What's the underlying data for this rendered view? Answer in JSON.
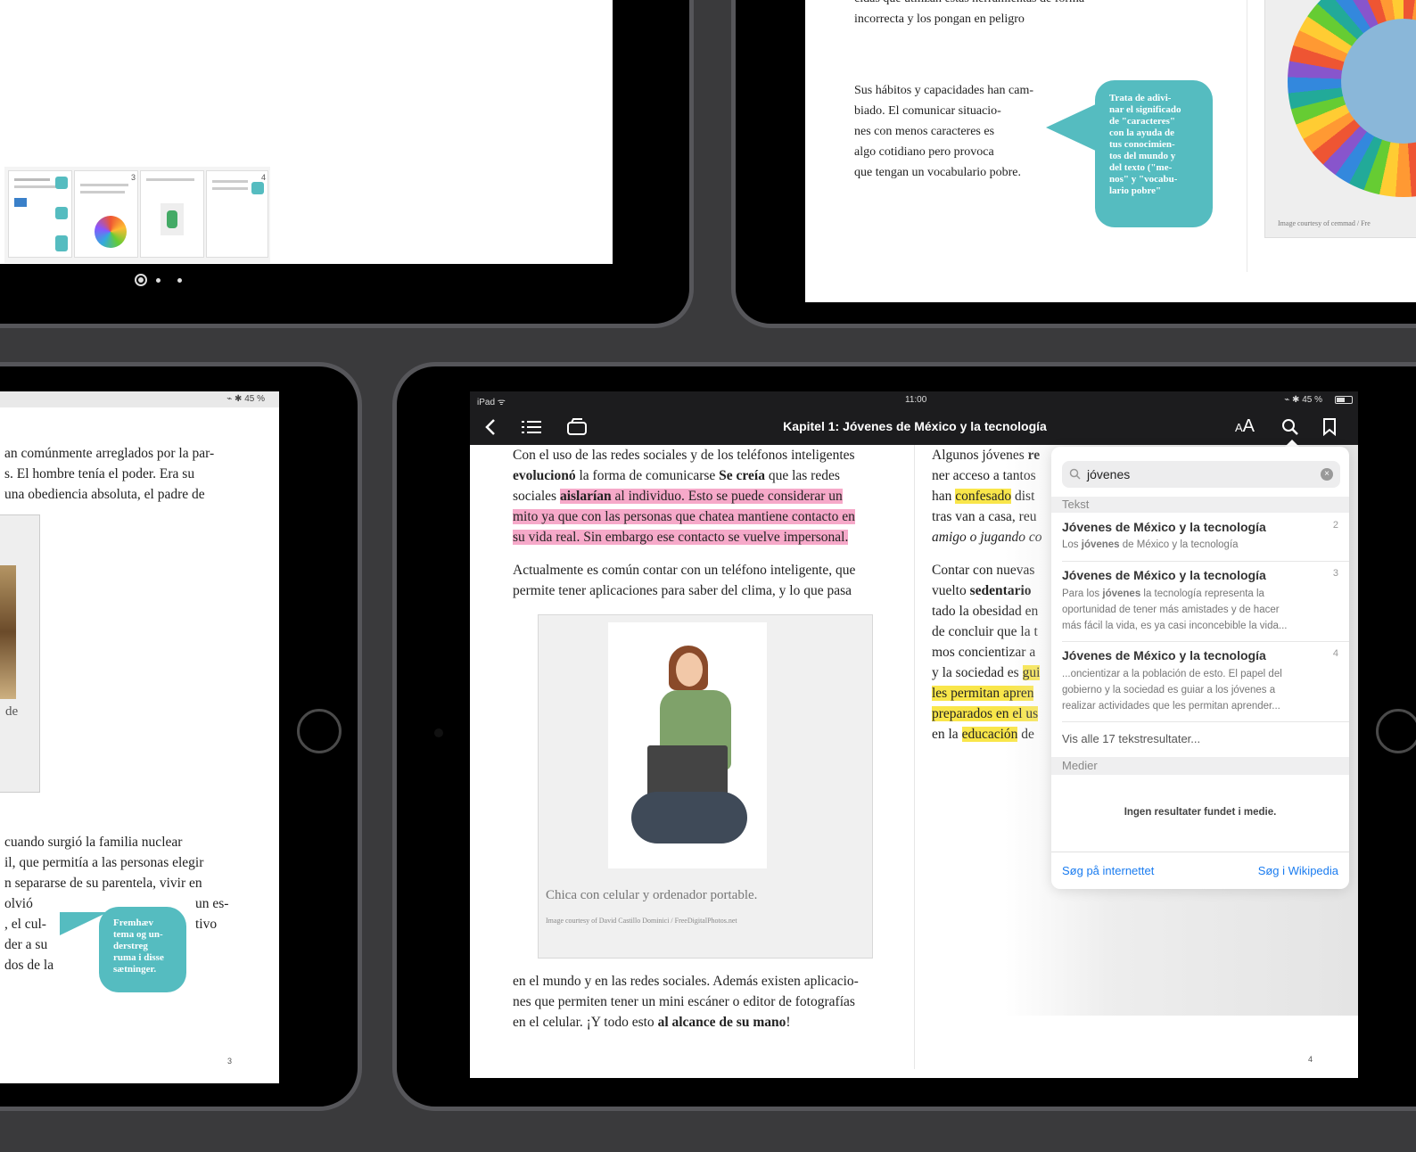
{
  "topleft": {
    "page_dots": [
      "current",
      "dot",
      "dot"
    ],
    "thumb_numbers": [
      "3",
      "4"
    ]
  },
  "topright": {
    "text_top": "cidas que utilizan estas herramientas de forma incorrecta y los pongan en peligro",
    "paragraph": [
      "Sus hábitos y capacidades han cam-",
      "biado. El comunicar situacio-",
      "nes con menos caracteres es",
      "algo cotidiano pero provoca",
      "que tengan un vocabulario pobre."
    ],
    "bubble": [
      "Trata de adivi-",
      "nar el significado",
      "de \"caracteres\"",
      "con la ayuda de",
      "tus conocimien-",
      "tos del mundo y",
      "del texto (\"me-",
      "nos\" y \"vocabu-",
      "lario pobre\""
    ],
    "caption": "Image courtesy of cemmad / Fre"
  },
  "bottomleft": {
    "status_right": "⌁ ✱ 45 %",
    "lines_top": [
      "an comúnmente arreglados por la par-",
      "s. El hombre tenía el poder. Era su",
      "una obediencia absoluta, el padre de"
    ],
    "de_label": "de",
    "lines_bottom": [
      "cuando surgió la familia nuclear",
      "il, que permitía a las personas elegir",
      "n separarse de su parentela, vivir en"
    ],
    "lines_side": [
      "olvió",
      ", el cul-",
      "der a su",
      "dos de la"
    ],
    "lines_right": [
      "un es-",
      "tivo"
    ],
    "bubble": [
      "Fremhæv",
      "tema og un-",
      "derstreg",
      "ruma i disse",
      "sætninger."
    ],
    "page_number": "3"
  },
  "main": {
    "status": {
      "left": "iPad ᯤ",
      "time": "11:00",
      "right": "⌁ ✱ 45 %"
    },
    "toolbar": {
      "title": "Kapitel 1: Jóvenes de México y la tecnología",
      "font_label": "AA"
    },
    "left_col": {
      "p1": {
        "l1": "Con el uso de las redes sociales y de los teléfonos inteligentes",
        "l2a": "evolucionó",
        "l2b": " la forma de comunicarse ",
        "l2c": "Se creía",
        "l2d": " que las redes",
        "l3a": "sociales ",
        "l3b": "aislarían",
        "l3c": " al individuo. Esto se puede considerar un",
        "l4": "mito ya que con las personas que chatea mantiene contacto en",
        "l5": "su vida real. Sin embargo ese contacto se vuelve impersonal."
      },
      "p2": [
        "Actualmente es común contar con un teléfono inteligente, que",
        "permite tener aplicaciones para saber del clima, y lo que pasa"
      ],
      "figure_caption": "Chica con celular y ordenador portable.",
      "figure_credit": "Image courtesy of David Castillo Dominici / FreeDigitalPhotos.net",
      "p3": {
        "l1": "en el mundo y en las redes sociales. Además  existen aplicacio-",
        "l2": "nes que permiten tener un mini escáner o editor de fotografías",
        "l3a": "en el celular. ¡Y todo esto ",
        "l3b": "al alcance de su mano",
        "l3c": "!"
      }
    },
    "right_col": {
      "r1a": "Algunos jóvenes ",
      "r1b": "re",
      "r2": "ner acceso a tantos",
      "r3a": "han ",
      "r3b": "confesado",
      "r3c": " dist",
      "r4": "tras van a casa, reu",
      "r5": "amigo o jugando co",
      "r6": "Contar con nuevas",
      "r7a": "vuelto ",
      "r7b": "sedentario",
      "r8": "tado la obesidad en",
      "r9": "de concluir que la t",
      "r10": "mos concientizar a",
      "r11a": "y la sociedad es ",
      "r11b": "gui",
      "r12": "les permitan apren",
      "r13": "preparados en el us",
      "r14a": "en la ",
      "r14b": "educación",
      "r14c": " de"
    },
    "page_number": "4",
    "search": {
      "query": "jóvenes",
      "section_text": "Tekst",
      "results": [
        {
          "title": "Jóvenes de México y la tecnología",
          "page": "2",
          "snippet_pre": "Los ",
          "snippet_bold": "jóvenes",
          "snippet_post": " de México y la tecnología",
          "snippet_lines": []
        },
        {
          "title": "Jóvenes de México y la tecnología",
          "page": "3",
          "snippet_pre": "Para los ",
          "snippet_bold": "jóvenes",
          "snippet_post": " la tecnología representa la",
          "snippet_lines": [
            "oportunidad de tener más amistades y de hacer",
            "más fácil la vida, es ya casi inconcebible la vida..."
          ]
        },
        {
          "title": "Jóvenes de México y la tecnología",
          "page": "4",
          "snippet_pre": "...oncientizar a la población de esto. El papel del",
          "snippet_bold": "",
          "snippet_post": "",
          "snippet_lines": [
            "gobierno y la sociedad es guiar a los jóvenes a",
            "realizar actividades que les permitan aprender..."
          ]
        }
      ],
      "show_all": "Vis alle 17 tekstresultater...",
      "section_media": "Medier",
      "no_media": "Ingen resultater fundet i medie.",
      "web_search": "Søg på internettet",
      "wiki_search": "Søg i Wikipedia"
    }
  },
  "colors": {
    "accent": "#1a7cf0",
    "teal_bubble": "#55bcc0",
    "pink_highlight": "#f6a9c9",
    "yellow_highlight": "#f9e64a",
    "toolbar_bg": "#1c1c1e"
  }
}
